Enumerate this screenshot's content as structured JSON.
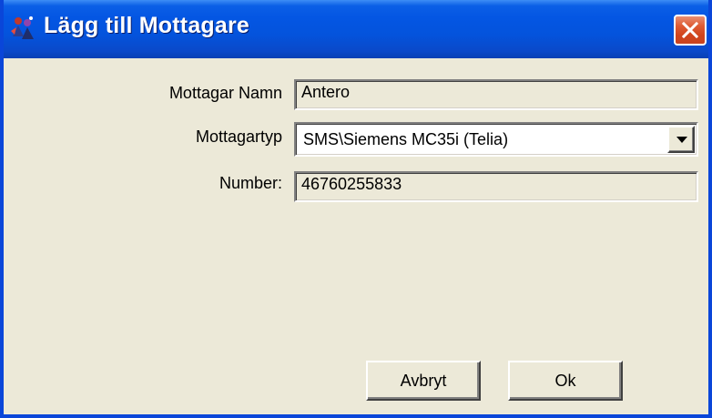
{
  "window": {
    "title": "Lägg till Mottagare",
    "app_icon": "people-icon",
    "close_icon": "close-icon"
  },
  "form": {
    "name_label": "Mottagar Namn",
    "name_value": "Antero",
    "type_label": "Mottagartyp",
    "type_value": "SMS\\Siemens MC35i (Telia)",
    "type_dropdown_icon": "chevron-down-icon",
    "number_label": "Number:",
    "number_value": "46760255833"
  },
  "buttons": {
    "cancel_label": "Avbryt",
    "ok_label": "Ok"
  },
  "colors": {
    "titlebar": "#0453dc",
    "close_button": "#d1441c",
    "dialog_background": "#ece9d8"
  }
}
